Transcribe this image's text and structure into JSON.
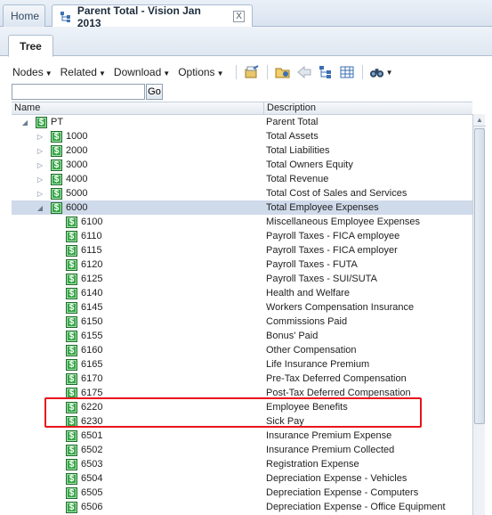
{
  "doc_tabs": {
    "home_label": "Home",
    "active_label": "Parent Total - Vision Jan 2013",
    "close_glyph": "X"
  },
  "inner_tab": {
    "label": "Tree"
  },
  "toolbar": {
    "menus": [
      "Nodes",
      "Related",
      "Download",
      "Options"
    ],
    "icons": [
      "export-icon",
      "open-folder-icon",
      "back-arrow-icon",
      "tree-view-icon",
      "grid-view-icon",
      "binoculars-icon"
    ]
  },
  "search": {
    "value": "",
    "go_label": "Go"
  },
  "grid": {
    "columns": [
      "Name",
      "Description"
    ],
    "rows": [
      {
        "name": "PT",
        "description": "Parent Total",
        "level": 0,
        "toggle": "expanded"
      },
      {
        "name": "1000",
        "description": "Total Assets",
        "level": 1,
        "toggle": "collapsed"
      },
      {
        "name": "2000",
        "description": "Total Liabilities",
        "level": 1,
        "toggle": "collapsed"
      },
      {
        "name": "3000",
        "description": "Total Owners Equity",
        "level": 1,
        "toggle": "collapsed"
      },
      {
        "name": "4000",
        "description": "Total Revenue",
        "level": 1,
        "toggle": "collapsed"
      },
      {
        "name": "5000",
        "description": "Total Cost of Sales and Services",
        "level": 1,
        "toggle": "collapsed"
      },
      {
        "name": "6000",
        "description": "Total Employee Expenses",
        "level": 1,
        "toggle": "expanded",
        "selected": true
      },
      {
        "name": "6100",
        "description": "Miscellaneous Employee Expenses",
        "level": 2,
        "toggle": "none"
      },
      {
        "name": "6110",
        "description": "Payroll Taxes - FICA employee",
        "level": 2,
        "toggle": "none"
      },
      {
        "name": "6115",
        "description": "Payroll Taxes - FICA employer",
        "level": 2,
        "toggle": "none"
      },
      {
        "name": "6120",
        "description": "Payroll Taxes - FUTA",
        "level": 2,
        "toggle": "none"
      },
      {
        "name": "6125",
        "description": "Payroll Taxes - SUI/SUTA",
        "level": 2,
        "toggle": "none"
      },
      {
        "name": "6140",
        "description": "Health and Welfare",
        "level": 2,
        "toggle": "none"
      },
      {
        "name": "6145",
        "description": "Workers Compensation Insurance",
        "level": 2,
        "toggle": "none"
      },
      {
        "name": "6150",
        "description": "Commissions Paid",
        "level": 2,
        "toggle": "none"
      },
      {
        "name": "6155",
        "description": "Bonus' Paid",
        "level": 2,
        "toggle": "none"
      },
      {
        "name": "6160",
        "description": "Other Compensation",
        "level": 2,
        "toggle": "none"
      },
      {
        "name": "6165",
        "description": "Life Insurance Premium",
        "level": 2,
        "toggle": "none"
      },
      {
        "name": "6170",
        "description": "Pre-Tax Deferred Compensation",
        "level": 2,
        "toggle": "none"
      },
      {
        "name": "6175",
        "description": "Post-Tax Deferred Compensation",
        "level": 2,
        "toggle": "none"
      },
      {
        "name": "6220",
        "description": "Employee Benefits",
        "level": 2,
        "toggle": "none"
      },
      {
        "name": "6230",
        "description": "Sick Pay",
        "level": 2,
        "toggle": "none"
      },
      {
        "name": "6501",
        "description": "Insurance Premium Expense",
        "level": 2,
        "toggle": "none"
      },
      {
        "name": "6502",
        "description": "Insurance Premium Collected",
        "level": 2,
        "toggle": "none"
      },
      {
        "name": "6503",
        "description": "Registration Expense",
        "level": 2,
        "toggle": "none"
      },
      {
        "name": "6504",
        "description": "Depreciation Expense - Vehicles",
        "level": 2,
        "toggle": "none"
      },
      {
        "name": "6505",
        "description": "Depreciation Expense - Computers",
        "level": 2,
        "toggle": "none"
      },
      {
        "name": "6506",
        "description": "Depreciation Expense - Office Equipment",
        "level": 2,
        "toggle": "none"
      }
    ]
  },
  "colors": {
    "selected_row": "#cfdaea",
    "highlight": "#e8131b",
    "node_icon": "#39a84a"
  }
}
